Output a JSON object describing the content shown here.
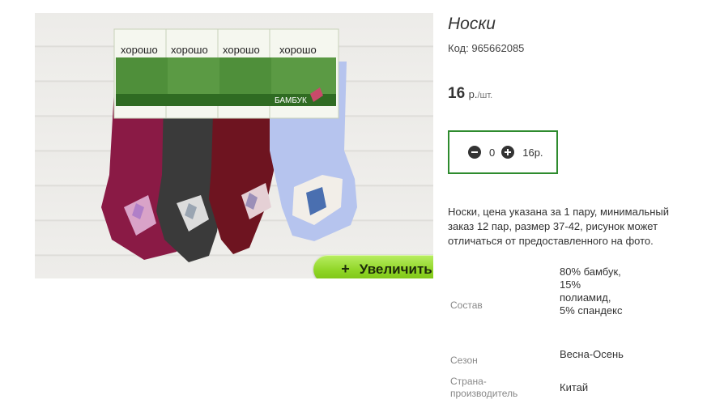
{
  "image": {
    "pack_label": "хорошо",
    "pack_material": "БАМБУК",
    "zoom_label": "Увеличить",
    "zoom_icon": "+",
    "sock_colors": [
      "#8a1a45",
      "#3a3a3a",
      "#6e1420",
      "#b6c4ee"
    ]
  },
  "product": {
    "title": "Носки",
    "code_label": "Код:",
    "code_value": "965662085",
    "price_value": "16",
    "price_currency": "р.",
    "price_unit": "/шт.",
    "quantity": "0",
    "total": "16р.",
    "description": "Носки, цена указана за 1 пару, минимальный заказ 12 пар, размер 37-42, рисунок может отличаться от предоставленного на фото."
  },
  "specs": [
    {
      "label": "Состав",
      "value": "80% бамбук, 15% полиамид, 5% спандекс"
    },
    {
      "label": "Сезон",
      "value": "Весна-Осень"
    },
    {
      "label": "Страна-производитель",
      "value": "Китай"
    }
  ],
  "colors": {
    "qty_border": "#2e8b2e",
    "zoom_button": "#8fd526"
  }
}
